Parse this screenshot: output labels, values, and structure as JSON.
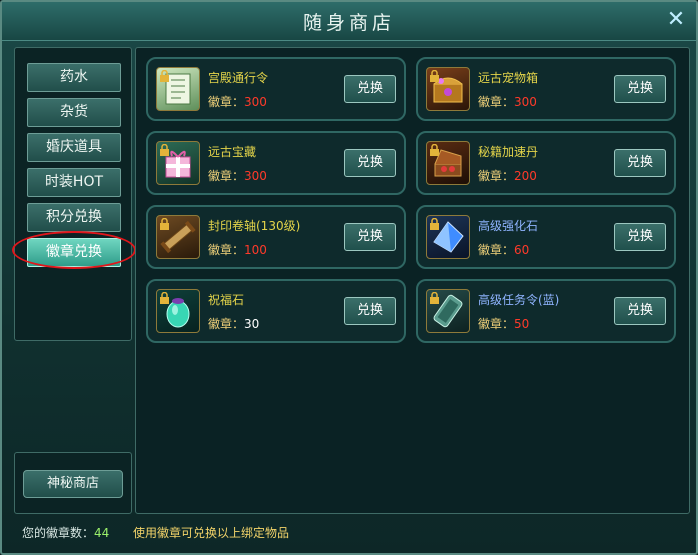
{
  "window": {
    "title": "随身商店",
    "close_icon": "close-icon"
  },
  "sidebar": {
    "tabs": [
      {
        "label": "药水"
      },
      {
        "label": "杂货"
      },
      {
        "label": "婚庆道具"
      },
      {
        "label": "时装HOT"
      },
      {
        "label": "积分兑换"
      },
      {
        "label": "徽章兑换",
        "selected": true
      }
    ],
    "mystery_shop_label": "神秘商店"
  },
  "items": [
    {
      "name": "宫殿通行令",
      "name_color": "#e4d44a",
      "cost_label": "徽章：",
      "cost": "300",
      "cost_color": "#ff3a2a",
      "button": "兑换",
      "icon": "scroll-icon",
      "locked": true
    },
    {
      "name": "远古宠物箱",
      "name_color": "#e4d44a",
      "cost_label": "徽章：",
      "cost": "300",
      "cost_color": "#ff3a2a",
      "button": "兑换",
      "icon": "treasure-chest-icon",
      "locked": true
    },
    {
      "name": "远古宝藏",
      "name_color": "#e4d44a",
      "cost_label": "徽章：",
      "cost": "300",
      "cost_color": "#ff3a2a",
      "button": "兑换",
      "icon": "gift-box-icon",
      "locked": true
    },
    {
      "name": "秘籍加速丹",
      "name_color": "#e4d44a",
      "cost_label": "徽章：",
      "cost": "200",
      "cost_color": "#ff3a2a",
      "button": "兑换",
      "icon": "pill-box-icon",
      "locked": true
    },
    {
      "name": "封印卷轴(130级)",
      "name_color": "#e4d44a",
      "cost_label": "徽章：",
      "cost": "100",
      "cost_color": "#ff3a2a",
      "button": "兑换",
      "icon": "sealed-scroll-icon",
      "locked": true
    },
    {
      "name": "高级强化石",
      "name_color": "#8fb4ff",
      "cost_label": "徽章：",
      "cost": "60",
      "cost_color": "#ff3a2a",
      "button": "兑换",
      "icon": "blue-crystal-icon",
      "locked": true
    },
    {
      "name": "祝福石",
      "name_color": "#e4d44a",
      "cost_label": "徽章：",
      "cost": "30",
      "cost_color": "#ffffff",
      "button": "兑换",
      "icon": "blessing-stone-icon",
      "locked": true
    },
    {
      "name": "高级任务令(蓝)",
      "name_color": "#8fb4ff",
      "cost_label": "徽章：",
      "cost": "50",
      "cost_color": "#ff3a2a",
      "button": "兑换",
      "icon": "task-token-icon",
      "locked": true
    }
  ],
  "footer": {
    "badge_count_label": "您的徽章数：",
    "badge_count": "44",
    "note": "使用徽章可兑换以上绑定物品"
  }
}
